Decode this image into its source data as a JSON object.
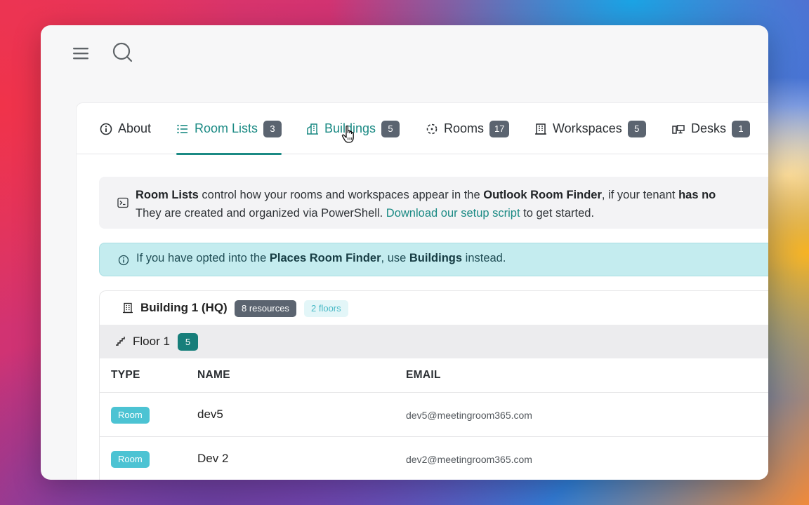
{
  "tabs": [
    {
      "label": "About",
      "icon": "info-circle-icon"
    },
    {
      "label": "Room Lists",
      "count": "3",
      "icon": "list-icon"
    },
    {
      "label": "Buildings",
      "count": "5",
      "icon": "buildings-icon"
    },
    {
      "label": "Rooms",
      "count": "17",
      "icon": "room-icon"
    },
    {
      "label": "Workspaces",
      "count": "5",
      "icon": "office-building-icon"
    },
    {
      "label": "Desks",
      "count": "1",
      "icon": "desk-icon"
    }
  ],
  "info": {
    "bold1": "Room Lists",
    "text1": " control how your rooms and workspaces appear in the ",
    "bold2": "Outlook Room Finder",
    "text2": ", if your tenant ",
    "bold3": "has no",
    "line2": "They are created and organized via PowerShell. ",
    "link": "Download our setup script",
    "line2_end": " to get started."
  },
  "notice": {
    "text1": "If you have opted into the ",
    "bold1": "Places Room Finder",
    "text2": ", use ",
    "bold2": "Buildings",
    "text3": " instead."
  },
  "building": {
    "title": "Building 1 (HQ)",
    "resources": "8 resources",
    "floors": "2 floors",
    "floor_label": "Floor 1",
    "floor_count": "5"
  },
  "table": {
    "headers": [
      "TYPE",
      "NAME",
      "EMAIL"
    ],
    "rows": [
      {
        "type": "Room",
        "name": "dev5",
        "email": "dev5@meetingroom365.com"
      },
      {
        "type": "Room",
        "name": "Dev 2",
        "email": "dev2@meetingroom365.com"
      }
    ]
  },
  "colors": {
    "accent": "#1b8a84",
    "badge": "#5b6470",
    "notice_bg": "#c4ecef",
    "type_badge": "#4cc3d3"
  }
}
